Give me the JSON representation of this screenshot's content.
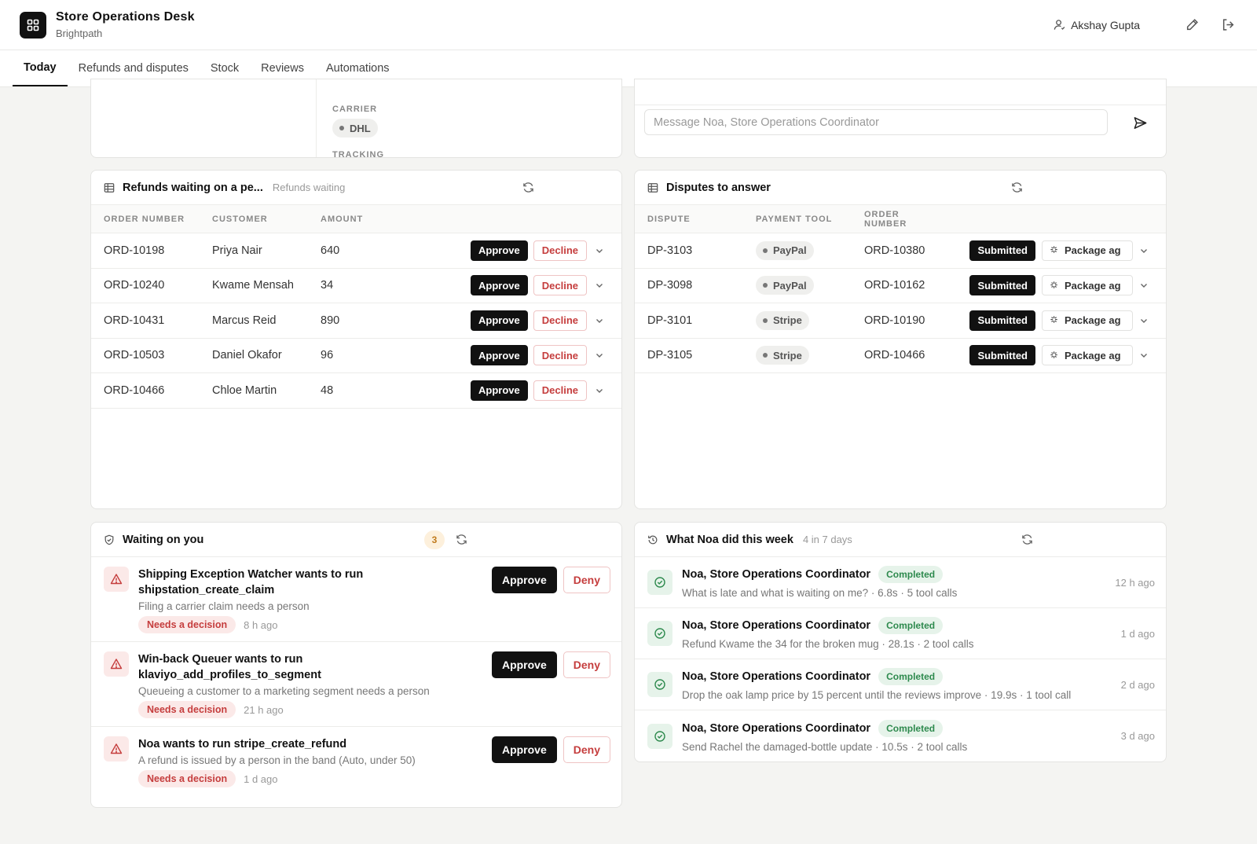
{
  "app": {
    "title": "Store Operations Desk",
    "org": "Brightpath",
    "user": "Akshay Gupta"
  },
  "tabs": [
    {
      "label": "Today",
      "active": true
    },
    {
      "label": "Refunds and disputes"
    },
    {
      "label": "Stock"
    },
    {
      "label": "Reviews"
    },
    {
      "label": "Automations"
    }
  ],
  "shipment": {
    "carrier_label": "CARRIER",
    "carrier": "DHL",
    "tracking_label": "TRACKING"
  },
  "chat": {
    "placeholder": "Message Noa, Store Operations Coordinator"
  },
  "refunds": {
    "title": "Refunds waiting on a pe...",
    "subtitle": "Refunds waiting",
    "columns": [
      "ORDER NUMBER",
      "CUSTOMER",
      "AMOUNT"
    ],
    "approve_label": "Approve",
    "decline_label": "Decline",
    "rows": [
      {
        "order": "ORD-10198",
        "customer": "Priya Nair",
        "amount": "640"
      },
      {
        "order": "ORD-10240",
        "customer": "Kwame Mensah",
        "amount": "34"
      },
      {
        "order": "ORD-10431",
        "customer": "Marcus Reid",
        "amount": "890"
      },
      {
        "order": "ORD-10503",
        "customer": "Daniel Okafor",
        "amount": "96"
      },
      {
        "order": "ORD-10466",
        "customer": "Chloe Martin",
        "amount": "48"
      }
    ]
  },
  "disputes": {
    "title": "Disputes to answer",
    "columns": [
      "DISPUTE",
      "PAYMENT TOOL",
      "ORDER NUMBER"
    ],
    "status_label": "Submitted",
    "reason_label": "Package ag",
    "rows": [
      {
        "dispute": "DP-3103",
        "tool": "PayPal",
        "order": "ORD-10380"
      },
      {
        "dispute": "DP-3098",
        "tool": "PayPal",
        "order": "ORD-10162"
      },
      {
        "dispute": "DP-3101",
        "tool": "Stripe",
        "order": "ORD-10190"
      },
      {
        "dispute": "DP-3105",
        "tool": "Stripe",
        "order": "ORD-10466"
      }
    ]
  },
  "waiting": {
    "title": "Waiting on you",
    "count": "3",
    "approve_label": "Approve",
    "deny_label": "Deny",
    "tag_label": "Needs a decision",
    "items": [
      {
        "title": "Shipping Exception Watcher wants to run shipstation_create_claim",
        "desc": "Filing a carrier claim needs a person",
        "time": "8 h ago"
      },
      {
        "title": "Win-back Queuer wants to run klaviyo_add_profiles_to_segment",
        "desc": "Queueing a customer to a marketing segment needs a person",
        "time": "21 h ago"
      },
      {
        "title": "Noa wants to run stripe_create_refund",
        "desc": "A refund is issued by a person in the band (Auto, under 50)",
        "time": "1 d ago"
      }
    ]
  },
  "activity": {
    "title": "What Noa did this week",
    "subtitle": "4 in 7 days",
    "status_label": "Completed",
    "items": [
      {
        "actor": "Noa, Store Operations Coordinator",
        "desc": "What is late and what is waiting on me? · 6.8s · 5 tool calls",
        "time": "12 h ago"
      },
      {
        "actor": "Noa, Store Operations Coordinator",
        "desc": "Refund Kwame the 34 for the broken mug · 28.1s · 2 tool calls",
        "time": "1 d ago"
      },
      {
        "actor": "Noa, Store Operations Coordinator",
        "desc": "Drop the oak lamp price by 15 percent until the reviews improve · 19.9s · 1 tool call",
        "time": "2 d ago"
      },
      {
        "actor": "Noa, Store Operations Coordinator",
        "desc": "Send Rachel the damaged-bottle update · 10.5s · 2 tool calls",
        "time": "3 d ago"
      }
    ]
  }
}
